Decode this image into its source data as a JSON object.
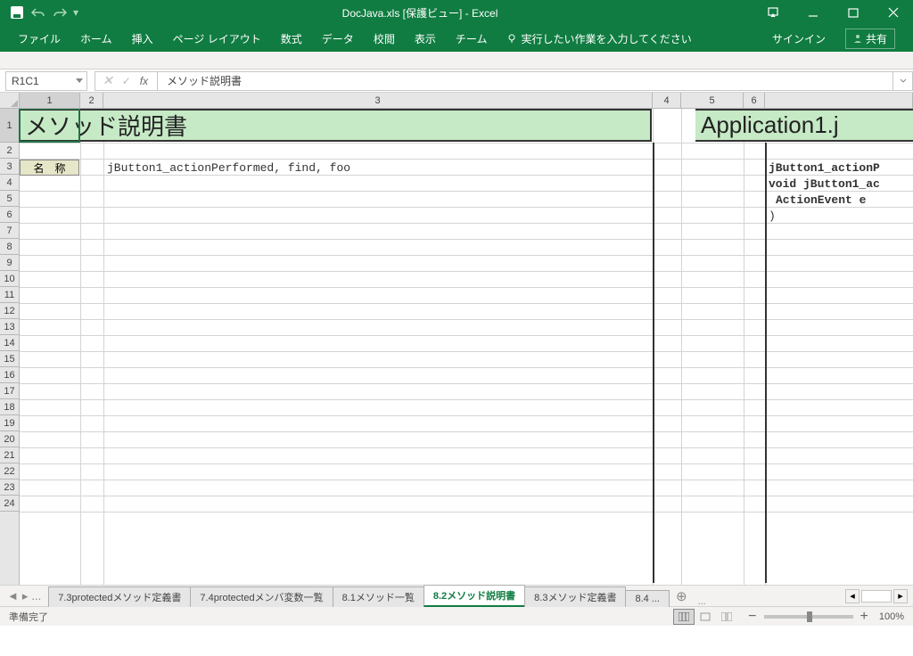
{
  "title": "DocJava.xls  [保護ビュー] - Excel",
  "qat": {
    "save": "save",
    "undo": "undo",
    "redo": "redo"
  },
  "ribbon": {
    "tabs": [
      "ファイル",
      "ホーム",
      "挿入",
      "ページ レイアウト",
      "数式",
      "データ",
      "校閲",
      "表示",
      "チーム"
    ],
    "tellme": "実行したい作業を入力してください",
    "signin": "サインイン",
    "share": "共有"
  },
  "namebox": "R1C1",
  "formula": "メソッド説明書",
  "columns": [
    "1",
    "2",
    "3",
    "4",
    "5",
    "6"
  ],
  "rows": [
    "1",
    "2",
    "3",
    "4",
    "5",
    "6",
    "7",
    "8",
    "9",
    "10",
    "11",
    "12",
    "13",
    "14",
    "15",
    "16",
    "17",
    "18",
    "19",
    "20",
    "21",
    "22",
    "23",
    "24"
  ],
  "cells": {
    "banner1": "メソッド説明書",
    "banner2": "Application1.j",
    "r3c1_label": "名　称",
    "r3c3": "jButton1_actionPerformed, find, foo",
    "r3c6": "jButton1_actionP",
    "r4c6": "void jButton1_ac",
    "r5c6": " ActionEvent e",
    "r6c6": ")"
  },
  "sheets": {
    "nav_more": "...",
    "tabs": [
      {
        "label": "7.3protectedメソッド定義書",
        "active": false
      },
      {
        "label": "7.4protectedメンバ変数一覧",
        "active": false
      },
      {
        "label": "8.1メソッド一覧",
        "active": false
      },
      {
        "label": "8.2メソッド説明書",
        "active": true
      },
      {
        "label": "8.3メソッド定義書",
        "active": false
      },
      {
        "label": "8.4 ...",
        "active": false
      }
    ],
    "more_right": "..."
  },
  "status": {
    "ready": "準備完了",
    "zoom": "100%"
  }
}
